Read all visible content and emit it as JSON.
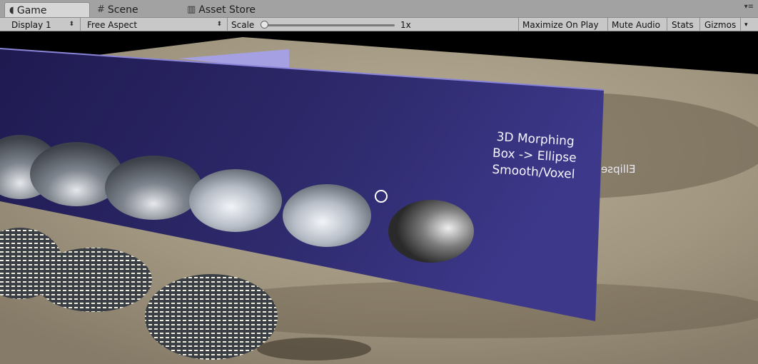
{
  "tabs": [
    {
      "label": "Game",
      "icon": "pacman-icon",
      "active": true
    },
    {
      "label": "Scene",
      "icon": "grid-icon",
      "active": false
    },
    {
      "label": "Asset Store",
      "icon": "store-icon",
      "active": false
    }
  ],
  "toolbar": {
    "display": "Display 1",
    "aspect": "Free Aspect",
    "scale_label": "Scale",
    "scale_value": "1x",
    "maximize": "Maximize On Play",
    "mute": "Mute Audio",
    "stats": "Stats",
    "gizmos": "Gizmos"
  },
  "scene": {
    "panel_text": [
      "3D Morphing",
      "Box -> Ellipse",
      "Smooth/Voxel"
    ],
    "mirrored_text": "Ellipse",
    "panel_color": "#2f2a70",
    "ground_color": "#a79c86"
  }
}
